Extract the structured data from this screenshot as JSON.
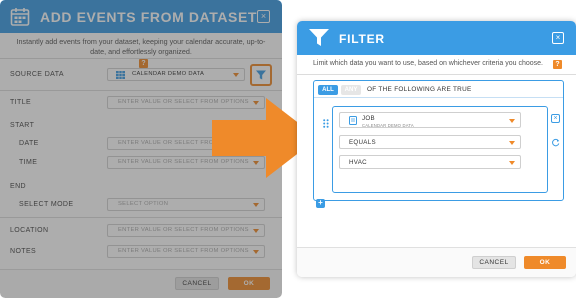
{
  "add_events": {
    "title": "ADD EVENTS FROM DATASET",
    "description": "Instantly add events from your dataset, keeping your calendar accurate, up-to-date, and effortlessly organized.",
    "help_label": "?",
    "close_label": "×",
    "fields": {
      "source_data": {
        "label": "SOURCE DATA",
        "value": "CALENDAR DEMO DATA"
      },
      "title": {
        "label": "TITLE",
        "placeholder": "ENTER VALUE OR SELECT FROM OPTIONS"
      },
      "start": {
        "label": "START"
      },
      "date": {
        "label": "DATE",
        "placeholder": "ENTER VALUE OR SELECT FROM OPTIONS"
      },
      "time": {
        "label": "TIME",
        "placeholder": "ENTER VALUE OR SELECT FROM OPTIONS"
      },
      "end": {
        "label": "END"
      },
      "select_mode": {
        "label": "SELECT MODE",
        "placeholder": "SELECT OPTION"
      },
      "location": {
        "label": "LOCATION",
        "placeholder": "ENTER VALUE OR SELECT FROM OPTIONS"
      },
      "notes": {
        "label": "NOTES",
        "placeholder": "ENTER VALUE OR SELECT FROM OPTIONS"
      }
    },
    "cancel_label": "CANCEL",
    "ok_label": "OK"
  },
  "filter": {
    "title": "FILTER",
    "description": "Limit which data you want to use, based on whichever criteria you choose.",
    "help_label": "?",
    "close_label": "×",
    "match_all_label": "ALL",
    "match_any_label": "ANY",
    "match_suffix": "OF THE FOLLOWING ARE TRUE",
    "condition": {
      "field": "JOB",
      "field_source": "CALENDAR DEMO DATA",
      "operator": "EQUALS",
      "value": "HVAC"
    },
    "remove_label": "×",
    "add_label": "+",
    "cancel_label": "CANCEL",
    "ok_label": "OK"
  },
  "colors": {
    "primary_blue": "#3b9ce4",
    "accent_orange": "#ef8a2a"
  }
}
